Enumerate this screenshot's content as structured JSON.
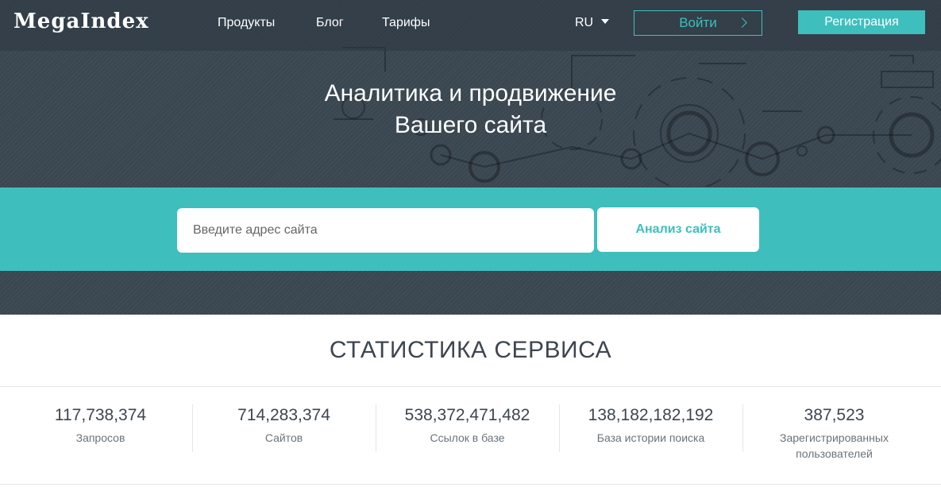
{
  "brand": {
    "logo_text": "MegaIndex"
  },
  "nav": {
    "links": [
      "Продукты",
      "Блог",
      "Тарифы"
    ],
    "language": "RU",
    "login_label": "Войти",
    "register_label": "Регистрация"
  },
  "hero": {
    "headline_line1": "Аналитика и продвижение",
    "headline_line2": "Вашего сайта"
  },
  "search": {
    "placeholder": "Введите адрес сайта",
    "button_label": "Анализ сайта"
  },
  "stats": {
    "title": "СТАТИСТИКА СЕРВИСА",
    "items": [
      {
        "value": "117,738,374",
        "label": "Запросов"
      },
      {
        "value": "714,283,374",
        "label": "Сайтов"
      },
      {
        "value": "538,372,471,482",
        "label": "Ссылок в базе"
      },
      {
        "value": "138,182,182,192",
        "label": "База истории поиска"
      },
      {
        "value": "387,523",
        "label": "Зарегистрированных пользователей"
      }
    ]
  },
  "colors": {
    "accent": "#3ebfbd",
    "dark_bg": "#3a4650",
    "text_dark": "#3d4650"
  }
}
